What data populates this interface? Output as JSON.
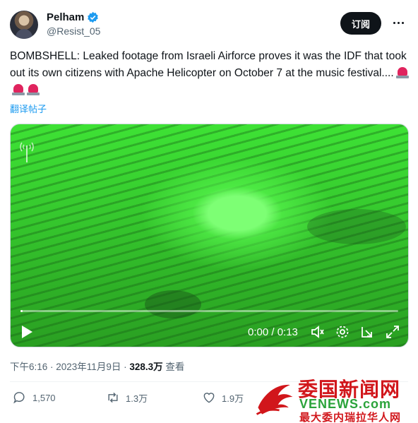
{
  "author": {
    "display_name": "Pelham",
    "handle": "@Resist_05"
  },
  "header": {
    "follow_label": "订阅"
  },
  "tweet": {
    "text": "BOMBSHELL: Leaked footage from Israeli Airforce proves it was the IDF that took out its own citizens with Apache Helicopter on October 7 at the music festival....",
    "translate_label": "翻译帖子"
  },
  "video": {
    "timecode": "0:00 / 0:13",
    "progress": 0.0
  },
  "meta": {
    "timestamp": "下午6:16 · 2023年11月9日 · ",
    "views_count": "328.3万",
    "views_label": "查看"
  },
  "actions": {
    "replies": "1,570",
    "reposts": "1.3万",
    "likes": "1.9万"
  },
  "watermark": {
    "cn": "委国新闻网",
    "en": "VENEWS.com",
    "sub": "最大委内瑞拉华人网"
  },
  "colors": {
    "accent": "#1d9bf0",
    "text": "#0f1419",
    "muted": "#536471",
    "video_green": "#3ee235"
  }
}
